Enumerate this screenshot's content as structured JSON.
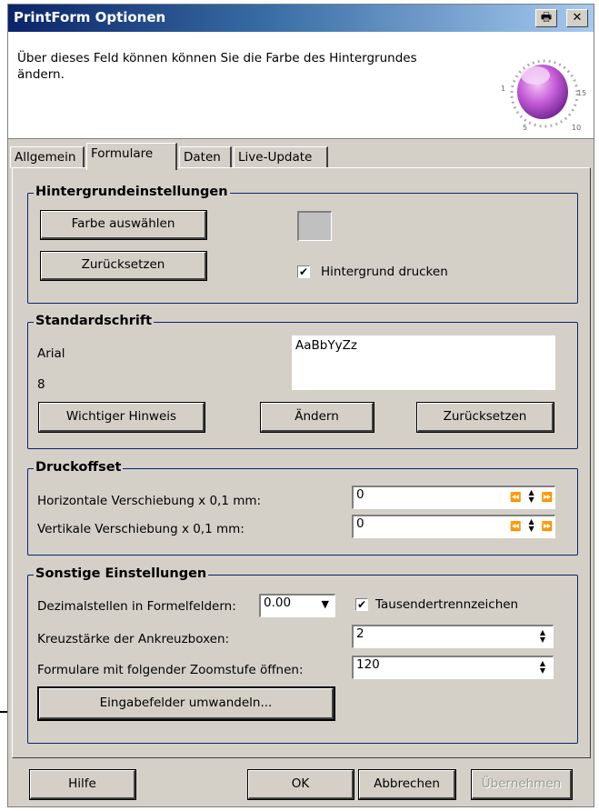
{
  "window": {
    "title": "PrintForm Optionen",
    "header_text": "Über dieses Feld können können Sie die Farbe des Hintergrundes ändern.",
    "knob_scale": [
      "1",
      "5",
      "10",
      "15"
    ]
  },
  "tabs": [
    "Allgemein",
    "Formulare",
    "Daten",
    "Live-Update"
  ],
  "active_tab": "Formulare",
  "background": {
    "legend": "Hintergrundeinstellungen",
    "choose_color": "Farbe auswählen",
    "reset": "Zurücksetzen",
    "print_background": "Hintergrund drucken",
    "print_background_checked": true,
    "swatch_color": "#c0c0c0"
  },
  "font": {
    "legend": "Standardschrift",
    "name": "Arial",
    "size": "8",
    "preview": "AaBbYyZz",
    "important_note": "Wichtiger Hinweis",
    "change": "Ändern",
    "reset": "Zurücksetzen"
  },
  "offset": {
    "legend": "Druckoffset",
    "horizontal_label": "Horizontale Verschiebung x 0,1 mm:",
    "horizontal_value": "0",
    "vertical_label": "Vertikale Verschiebung x 0,1 mm:",
    "vertical_value": "0"
  },
  "misc": {
    "legend": "Sonstige Einstellungen",
    "decimals_label": "Dezimalstellen in Formelfeldern:",
    "decimals_value": "0.00",
    "thousands_label": "Tausendertrennzeichen",
    "thousands_checked": true,
    "crosssize_label": "Kreuzstärke der Ankreuzboxen:",
    "crosssize_value": "2",
    "zoom_label": "Formulare mit folgender Zoomstufe öffnen:",
    "zoom_value": "120",
    "convert_button": "Eingabefelder umwandeln..."
  },
  "footer": {
    "help": "Hilfe",
    "ok": "OK",
    "cancel": "Abbrechen",
    "apply": "Übernehmen"
  }
}
